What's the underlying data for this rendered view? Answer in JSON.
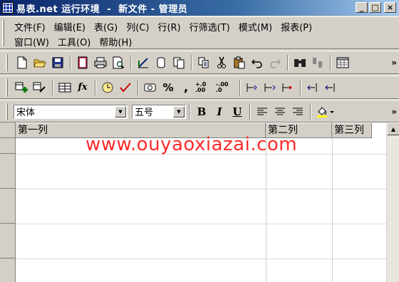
{
  "window": {
    "title": "易表.net 运行环境  -  新文件 - 管理员",
    "min_label": "_",
    "max_label": "□",
    "close_label": "×"
  },
  "menu": {
    "row1": [
      "文件(F)",
      "编辑(E)",
      "表(G)",
      "列(C)",
      "行(R)",
      "行筛选(T)",
      "模式(M)",
      "报表(P)"
    ],
    "row2": [
      "窗口(W)",
      "工具(O)",
      "帮助(H)"
    ]
  },
  "toolbar1": {
    "icons": [
      "new-file-icon",
      "open-folder-icon",
      "save-icon",
      "book-icon",
      "print-icon",
      "print-preview-icon",
      "design-icon",
      "cylinder-icon",
      "copy-doc-icon",
      "copy-icon",
      "cut-icon",
      "paste-icon",
      "undo-icon",
      "redo-icon",
      "find-icon",
      "replace-icon",
      "table-edit-icon"
    ],
    "overflow": "»"
  },
  "toolbar2": {
    "icons": [
      "add-column-icon",
      "edit-column-icon",
      "table-icon",
      "function-icon",
      "clock-icon",
      "check-icon",
      "currency-icon",
      "percent-icon",
      "comma-icon",
      "increase-decimal-icon",
      "decrease-decimal-icon",
      "indent-left-icon",
      "indent-both-icon",
      "indent-right-icon",
      "outdent-left-icon",
      "outdent-both-icon"
    ],
    "fx_label": "fx",
    "percent_label": "%",
    "comma_label": ",",
    "inc_dec_label": "+.0 .00",
    "dec_dec_label": "-.00 .0"
  },
  "toolbar3": {
    "font_name": "宋体",
    "font_size": "五号",
    "bold_label": "B",
    "italic_label": "I",
    "underline_label": "U",
    "overflow": "»"
  },
  "grid": {
    "columns": [
      "第一列",
      "第二列",
      "第三列"
    ]
  },
  "watermark": "www.ouyaoxiazai.com"
}
